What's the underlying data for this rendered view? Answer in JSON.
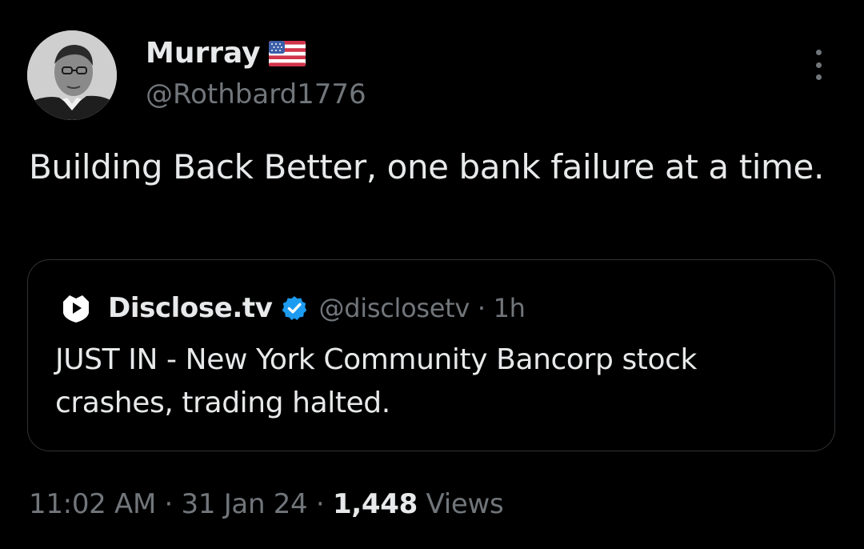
{
  "tweet": {
    "author": {
      "display_name": "Murray",
      "handle": "@Rothbard1776",
      "flag_icon": "us-flag-icon",
      "avatar_icon": "avatar-photo"
    },
    "text": "Building Back Better, one bank failure at a time.",
    "more_icon": "more-options-icon",
    "quoted": {
      "display_name": "Disclose.tv",
      "handle": "@disclosetv",
      "separator": "·",
      "age": "1h",
      "verified_color": "#1d9bf0",
      "text": "JUST IN - New York Community Bancorp stock crashes, trading halted."
    },
    "meta": {
      "time": "11:02 AM",
      "separator": "·",
      "date": "31 Jan 24",
      "views_count": "1,448",
      "views_label": "Views"
    }
  },
  "colors": {
    "background": "#000000",
    "primary_text": "#e7e9ea",
    "secondary_text": "#71767b",
    "border": "#2f3336",
    "verified": "#1d9bf0"
  }
}
